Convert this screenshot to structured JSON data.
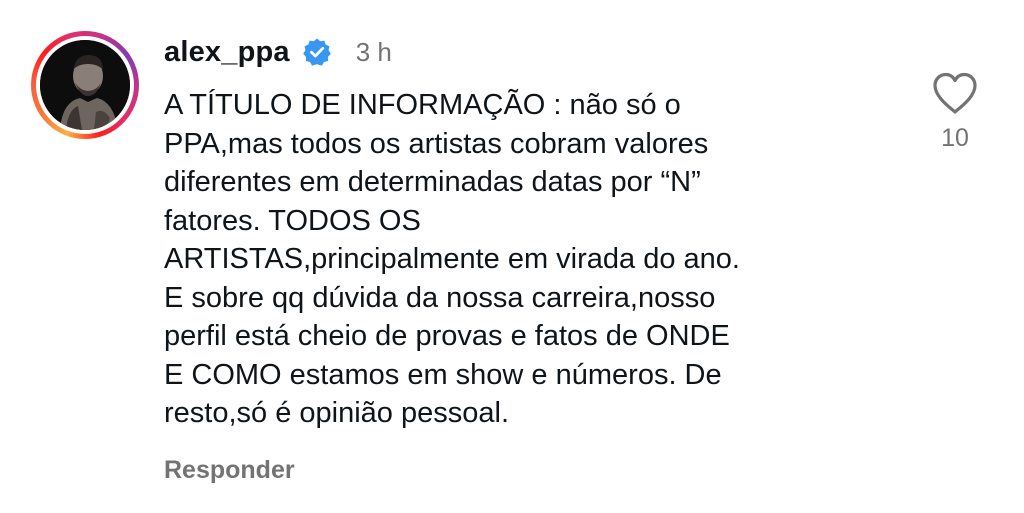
{
  "comment": {
    "username": "alex_ppa",
    "verified_icon": "verified-badge-icon",
    "time": "3 h",
    "text": "A TÍTULO DE INFORMAÇÃO : não só o\nPPA,mas todos os artistas cobram valores\ndiferentes em determinadas datas por “N”\nfatores. TODOS OS\nARTISTAS,principalmente em virada do ano.\nE sobre qq dúvida da nossa carreira,nosso\nperfil está cheio de provas e fatos de ONDE\nE COMO estamos em show e números. De\nresto,só é opinião pessoal.",
    "reply_label": "Responder",
    "like_icon": "heart-outline-icon",
    "like_count": "10"
  },
  "colors": {
    "verified_blue": "#3897f0",
    "muted_gray": "#737373",
    "text": "#0f1419"
  }
}
